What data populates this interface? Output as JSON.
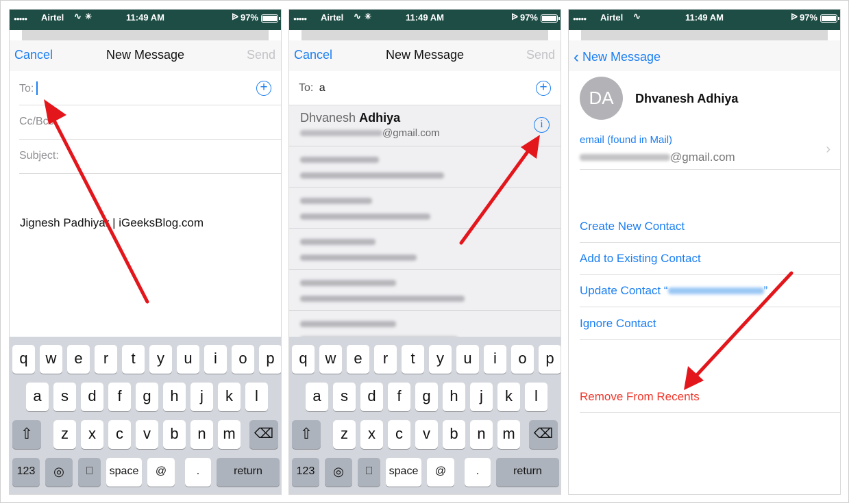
{
  "status": {
    "carrier": "Airtel",
    "time": "11:49 AM",
    "battery": "97%"
  },
  "compose": {
    "cancel": "Cancel",
    "title": "New Message",
    "send": "Send",
    "to_label": "To:",
    "cc_label": "Cc/Bcc:",
    "subject_label": "Subject:",
    "signature": "Jignesh Padhiyar | iGeeksBlog.com"
  },
  "suggest": {
    "to_label": "To:",
    "to_value": "a",
    "top_first": "Dhvanesh",
    "top_last": "Adhiya",
    "top_email": "@gmail.com"
  },
  "keyboard": {
    "row1": [
      "q",
      "w",
      "e",
      "r",
      "t",
      "y",
      "u",
      "i",
      "o",
      "p"
    ],
    "row2": [
      "a",
      "s",
      "d",
      "f",
      "g",
      "h",
      "j",
      "k",
      "l"
    ],
    "row3": [
      "z",
      "x",
      "c",
      "v",
      "b",
      "n",
      "m"
    ],
    "num": "123",
    "space": "space",
    "at": "@",
    "dot": ".",
    "return": "return"
  },
  "contact": {
    "back": "New Message",
    "initials": "DA",
    "name": "Dhvanesh Adhiya",
    "email_label": "email (found in Mail)",
    "email_domain": "@gmail.com",
    "actions": [
      "Create New Contact",
      "Add to Existing Contact",
      "Ignore Contact"
    ],
    "update_prefix": "Update Contact “",
    "update_suffix": "”",
    "remove": "Remove From Recents"
  },
  "colors": {
    "accent": "#1a7ef2",
    "destructive": "#f0362a",
    "annotation": "#e3161c",
    "statusbar": "#1d4d45"
  }
}
